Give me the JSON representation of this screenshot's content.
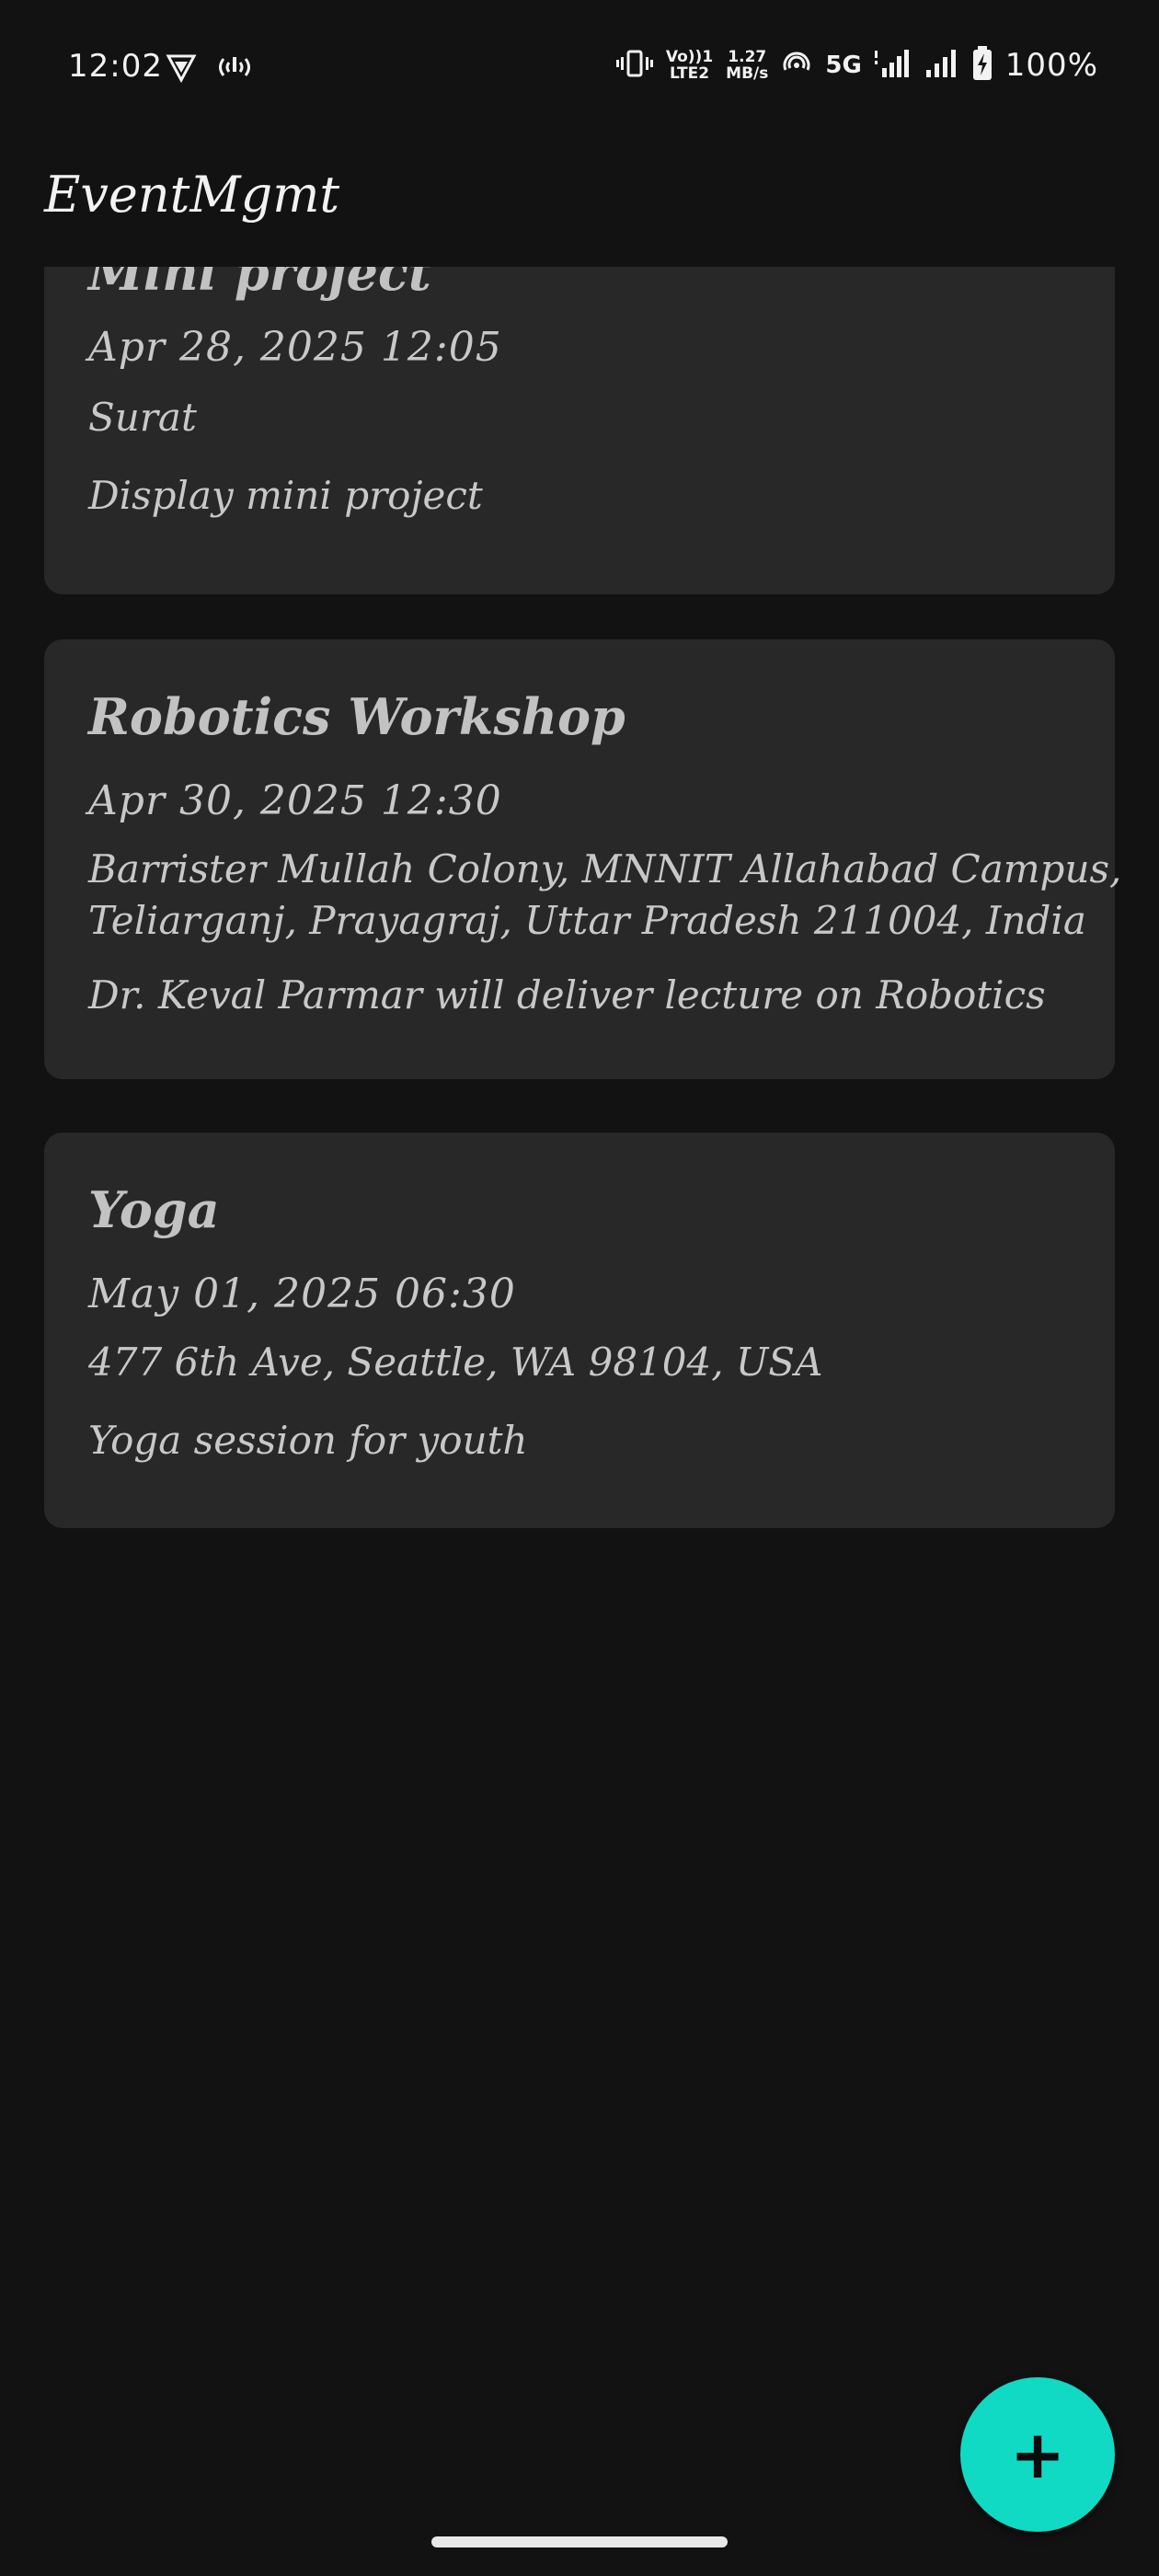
{
  "status_bar": {
    "time": "12:02",
    "lte_label_top": "Vo))1",
    "lte_label_bottom": "LTE2",
    "speed_top": "1.27",
    "speed_bottom": "MB/s",
    "network": "5G",
    "battery": "100%"
  },
  "app_bar": {
    "title": "EventMgmt"
  },
  "events": [
    {
      "title": "Mini project",
      "date": "Apr 28, 2025 12:05",
      "location": "Surat",
      "description": "Display mini project"
    },
    {
      "title": "Robotics Workshop",
      "date": "Apr 30, 2025 12:30",
      "location_line1": "Barrister Mullah Colony, MNNIT Allahabad Campus,",
      "location_line2": "Teliarganj, Prayagraj, Uttar Pradesh 211004, India",
      "description": "Dr. Keval Parmar will deliver lecture on Robotics"
    },
    {
      "title": "Yoga",
      "date": "May 01, 2025 06:30",
      "location": "477 6th Ave, Seattle, WA 98104, USA",
      "description": "Yoga session for youth"
    }
  ],
  "fab": {
    "icon": "plus-icon",
    "symbol": "+"
  },
  "colors": {
    "background": "#121212",
    "card": "#282828",
    "accent": "#10d9c4",
    "text": "#c8c8c8"
  }
}
